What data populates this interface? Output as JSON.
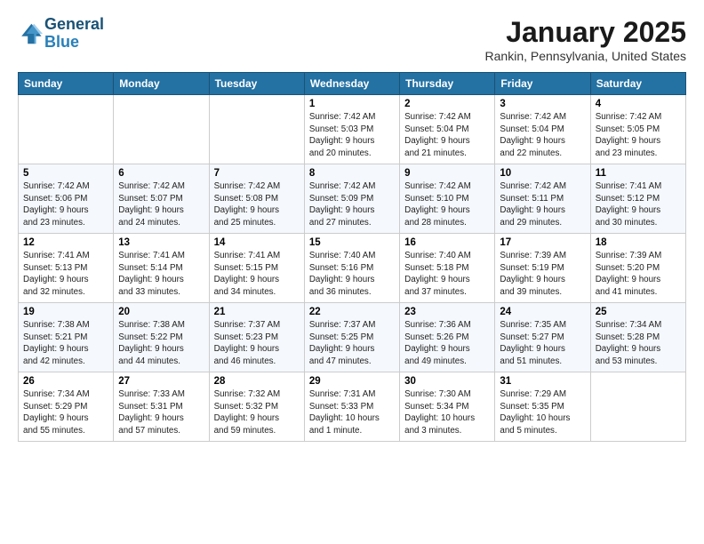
{
  "logo": {
    "line1": "General",
    "line2": "Blue"
  },
  "title": "January 2025",
  "location": "Rankin, Pennsylvania, United States",
  "days_of_week": [
    "Sunday",
    "Monday",
    "Tuesday",
    "Wednesday",
    "Thursday",
    "Friday",
    "Saturday"
  ],
  "weeks": [
    [
      {
        "day": "",
        "detail": ""
      },
      {
        "day": "",
        "detail": ""
      },
      {
        "day": "",
        "detail": ""
      },
      {
        "day": "1",
        "detail": "Sunrise: 7:42 AM\nSunset: 5:03 PM\nDaylight: 9 hours\nand 20 minutes."
      },
      {
        "day": "2",
        "detail": "Sunrise: 7:42 AM\nSunset: 5:04 PM\nDaylight: 9 hours\nand 21 minutes."
      },
      {
        "day": "3",
        "detail": "Sunrise: 7:42 AM\nSunset: 5:04 PM\nDaylight: 9 hours\nand 22 minutes."
      },
      {
        "day": "4",
        "detail": "Sunrise: 7:42 AM\nSunset: 5:05 PM\nDaylight: 9 hours\nand 23 minutes."
      }
    ],
    [
      {
        "day": "5",
        "detail": "Sunrise: 7:42 AM\nSunset: 5:06 PM\nDaylight: 9 hours\nand 23 minutes."
      },
      {
        "day": "6",
        "detail": "Sunrise: 7:42 AM\nSunset: 5:07 PM\nDaylight: 9 hours\nand 24 minutes."
      },
      {
        "day": "7",
        "detail": "Sunrise: 7:42 AM\nSunset: 5:08 PM\nDaylight: 9 hours\nand 25 minutes."
      },
      {
        "day": "8",
        "detail": "Sunrise: 7:42 AM\nSunset: 5:09 PM\nDaylight: 9 hours\nand 27 minutes."
      },
      {
        "day": "9",
        "detail": "Sunrise: 7:42 AM\nSunset: 5:10 PM\nDaylight: 9 hours\nand 28 minutes."
      },
      {
        "day": "10",
        "detail": "Sunrise: 7:42 AM\nSunset: 5:11 PM\nDaylight: 9 hours\nand 29 minutes."
      },
      {
        "day": "11",
        "detail": "Sunrise: 7:41 AM\nSunset: 5:12 PM\nDaylight: 9 hours\nand 30 minutes."
      }
    ],
    [
      {
        "day": "12",
        "detail": "Sunrise: 7:41 AM\nSunset: 5:13 PM\nDaylight: 9 hours\nand 32 minutes."
      },
      {
        "day": "13",
        "detail": "Sunrise: 7:41 AM\nSunset: 5:14 PM\nDaylight: 9 hours\nand 33 minutes."
      },
      {
        "day": "14",
        "detail": "Sunrise: 7:41 AM\nSunset: 5:15 PM\nDaylight: 9 hours\nand 34 minutes."
      },
      {
        "day": "15",
        "detail": "Sunrise: 7:40 AM\nSunset: 5:16 PM\nDaylight: 9 hours\nand 36 minutes."
      },
      {
        "day": "16",
        "detail": "Sunrise: 7:40 AM\nSunset: 5:18 PM\nDaylight: 9 hours\nand 37 minutes."
      },
      {
        "day": "17",
        "detail": "Sunrise: 7:39 AM\nSunset: 5:19 PM\nDaylight: 9 hours\nand 39 minutes."
      },
      {
        "day": "18",
        "detail": "Sunrise: 7:39 AM\nSunset: 5:20 PM\nDaylight: 9 hours\nand 41 minutes."
      }
    ],
    [
      {
        "day": "19",
        "detail": "Sunrise: 7:38 AM\nSunset: 5:21 PM\nDaylight: 9 hours\nand 42 minutes."
      },
      {
        "day": "20",
        "detail": "Sunrise: 7:38 AM\nSunset: 5:22 PM\nDaylight: 9 hours\nand 44 minutes."
      },
      {
        "day": "21",
        "detail": "Sunrise: 7:37 AM\nSunset: 5:23 PM\nDaylight: 9 hours\nand 46 minutes."
      },
      {
        "day": "22",
        "detail": "Sunrise: 7:37 AM\nSunset: 5:25 PM\nDaylight: 9 hours\nand 47 minutes."
      },
      {
        "day": "23",
        "detail": "Sunrise: 7:36 AM\nSunset: 5:26 PM\nDaylight: 9 hours\nand 49 minutes."
      },
      {
        "day": "24",
        "detail": "Sunrise: 7:35 AM\nSunset: 5:27 PM\nDaylight: 9 hours\nand 51 minutes."
      },
      {
        "day": "25",
        "detail": "Sunrise: 7:34 AM\nSunset: 5:28 PM\nDaylight: 9 hours\nand 53 minutes."
      }
    ],
    [
      {
        "day": "26",
        "detail": "Sunrise: 7:34 AM\nSunset: 5:29 PM\nDaylight: 9 hours\nand 55 minutes."
      },
      {
        "day": "27",
        "detail": "Sunrise: 7:33 AM\nSunset: 5:31 PM\nDaylight: 9 hours\nand 57 minutes."
      },
      {
        "day": "28",
        "detail": "Sunrise: 7:32 AM\nSunset: 5:32 PM\nDaylight: 9 hours\nand 59 minutes."
      },
      {
        "day": "29",
        "detail": "Sunrise: 7:31 AM\nSunset: 5:33 PM\nDaylight: 10 hours\nand 1 minute."
      },
      {
        "day": "30",
        "detail": "Sunrise: 7:30 AM\nSunset: 5:34 PM\nDaylight: 10 hours\nand 3 minutes."
      },
      {
        "day": "31",
        "detail": "Sunrise: 7:29 AM\nSunset: 5:35 PM\nDaylight: 10 hours\nand 5 minutes."
      },
      {
        "day": "",
        "detail": ""
      }
    ]
  ]
}
